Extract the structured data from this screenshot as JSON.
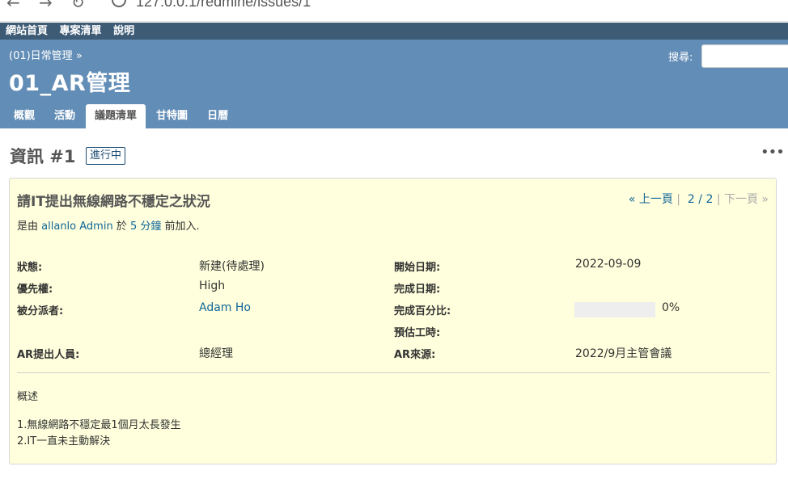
{
  "browser": {
    "back_icon": "arrow-left-icon",
    "forward_icon": "arrow-right-icon",
    "reload_icon": "reload-icon",
    "url": "127.0.0.1/redmine/issues/1"
  },
  "top_menu": {
    "items": [
      "網站首頁",
      "專案清單",
      "說明"
    ]
  },
  "header": {
    "breadcrumb": "(01)日常管理 »",
    "project_title": "01_AR管理",
    "search_label": "搜尋:",
    "search_value": ""
  },
  "tabs": [
    {
      "label": "概觀",
      "selected": false
    },
    {
      "label": "活動",
      "selected": false
    },
    {
      "label": "議題清單",
      "selected": true
    },
    {
      "label": "甘特圖",
      "selected": false
    },
    {
      "label": "日曆",
      "selected": false
    }
  ],
  "issue": {
    "heading": "資訊 #1",
    "status_badge": "進行中",
    "more_icon": "more-horizontal-icon",
    "subject": "請IT提出無線網路不穩定之狀況",
    "prev_label": "« 上一頁",
    "separator1": "|",
    "counter": "2 / 2",
    "separator2": "|",
    "next_label": "下一頁 »",
    "author_prefix": "是由",
    "author": "allanlo Admin",
    "author_mid": "於",
    "time_ago": "5 分鐘",
    "author_suffix": "前加入.",
    "attributes": {
      "status_label": "狀態:",
      "status_value": "新建(待處理)",
      "priority_label": "優先權:",
      "priority_value": "High",
      "assignee_label": "被分派者:",
      "assignee_value": "Adam Ho",
      "submitter_label": "AR提出人員:",
      "submitter_value": "總經理",
      "start_label": "開始日期:",
      "start_value": "2022-09-09",
      "due_label": "完成日期:",
      "due_value": "",
      "done_label": "完成百分比:",
      "done_value": "0%",
      "done_ratio": 0,
      "estimate_label": "預估工時:",
      "estimate_value": "",
      "source_label": "AR來源:",
      "source_value": "2022/9月主管會議"
    },
    "description_label": "概述",
    "description_lines": [
      "1.無線網路不穩定最1個月太長發生",
      "2.IT一直未主動解決"
    ]
  },
  "colors": {
    "top_menu_bg": "#3e5b76",
    "header_bg": "#628db6",
    "link": "#116699",
    "issue_box_bg": "#ffffdd"
  }
}
